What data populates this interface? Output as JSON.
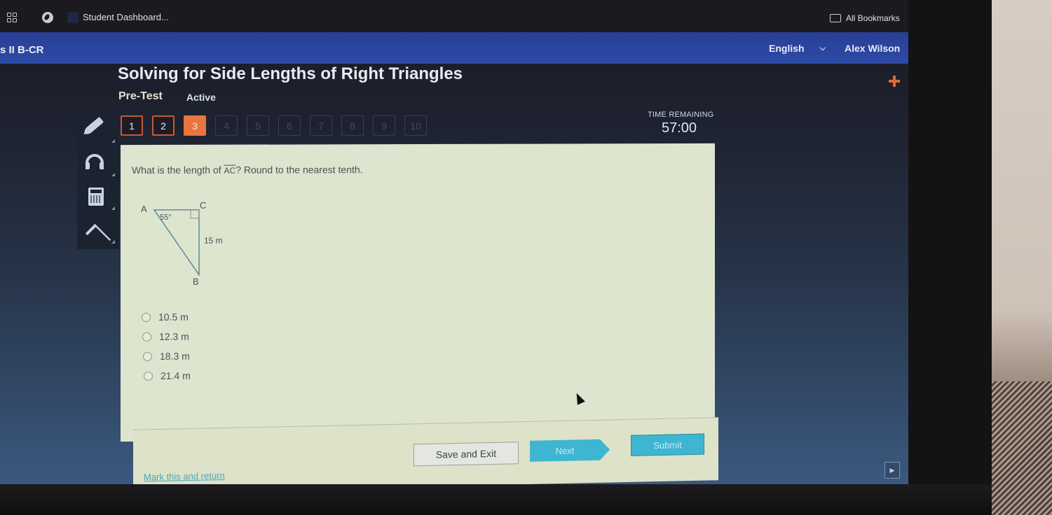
{
  "browser": {
    "tab_title": "Student Dashboard...",
    "bookmarks_label": "All Bookmarks"
  },
  "header": {
    "course": "s II B-CR",
    "language": "English",
    "user": "Alex Wilson"
  },
  "lesson": {
    "title": "Solving for Side Lengths of Right Triangles",
    "type": "Pre-Test",
    "status": "Active"
  },
  "question_nav": {
    "items": [
      {
        "label": "1",
        "state": "answered"
      },
      {
        "label": "2",
        "state": "answered"
      },
      {
        "label": "3",
        "state": "current"
      },
      {
        "label": "4",
        "state": "locked"
      },
      {
        "label": "5",
        "state": "locked"
      },
      {
        "label": "6",
        "state": "locked"
      },
      {
        "label": "7",
        "state": "locked"
      },
      {
        "label": "8",
        "state": "locked"
      },
      {
        "label": "9",
        "state": "locked"
      },
      {
        "label": "10",
        "state": "locked"
      }
    ]
  },
  "timer": {
    "label": "TIME REMAINING",
    "value": "57:00"
  },
  "tools": [
    "pencil-icon",
    "headphones-icon",
    "calculator-icon",
    "caret-icon"
  ],
  "question": {
    "prefix": "What is the length of ",
    "segment": "AC",
    "suffix": "? Round to the nearest tenth.",
    "diagram": {
      "vertex_a": "A",
      "vertex_b": "B",
      "vertex_c": "C",
      "angle_a": "55°",
      "side_cb": "15 m"
    },
    "choices": [
      "10.5 m",
      "12.3 m",
      "18.3 m",
      "21.4 m"
    ]
  },
  "footer": {
    "mark_link": "Mark this and return",
    "save_exit": "Save and Exit",
    "next": "Next",
    "submit": "Submit"
  },
  "colors": {
    "accent_orange": "#e9753e",
    "button_teal": "#3fb6d1",
    "header_blue": "#2c4aa6"
  }
}
